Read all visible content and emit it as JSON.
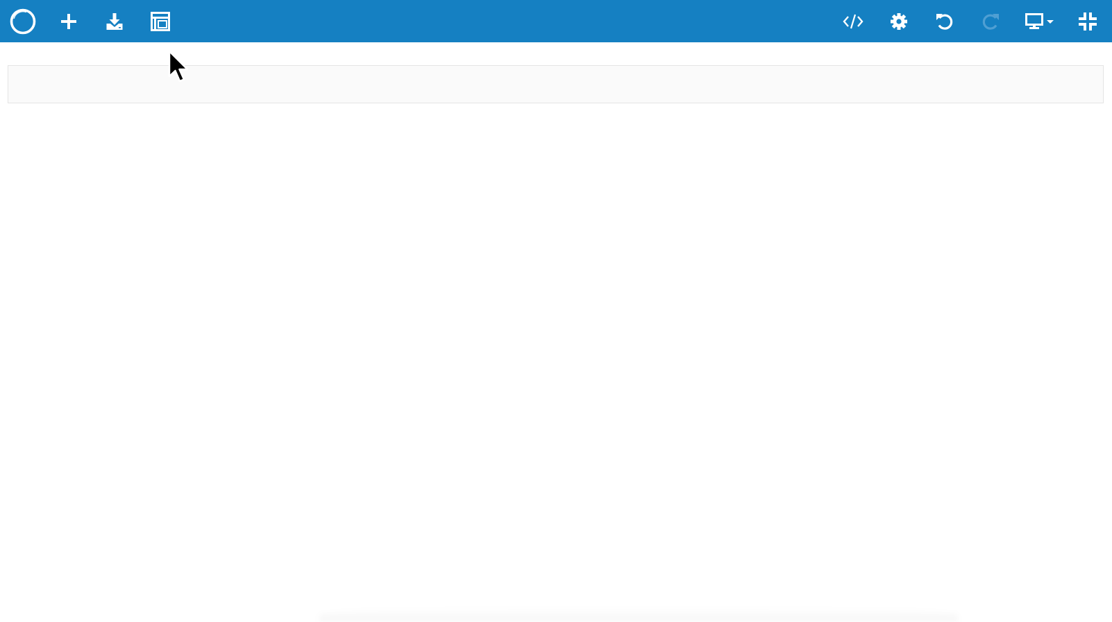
{
  "theme": {
    "toolbar_bg": "#1580c2",
    "icon_color": "#ffffff",
    "icon_disabled_color": "#4f9fd3",
    "section_bg": "#fafafa",
    "section_border": "#e4e4e4"
  },
  "toolbar": {
    "left": [
      {
        "icon": "logo-ring-icon",
        "enabled": true
      },
      {
        "icon": "plus-icon",
        "enabled": true
      },
      {
        "icon": "download-icon",
        "enabled": true
      },
      {
        "icon": "layout-icon",
        "enabled": true
      }
    ],
    "right": [
      {
        "icon": "code-icon",
        "enabled": true
      },
      {
        "icon": "gear-icon",
        "enabled": true
      },
      {
        "icon": "undo-icon",
        "enabled": true
      },
      {
        "icon": "redo-icon",
        "enabled": false
      },
      {
        "icon": "desktop-device-icon",
        "enabled": true,
        "has_dropdown": true
      },
      {
        "icon": "compress-icon",
        "enabled": true
      }
    ]
  },
  "canvas": {
    "sections": [
      {
        "type": "empty-section"
      }
    ]
  }
}
